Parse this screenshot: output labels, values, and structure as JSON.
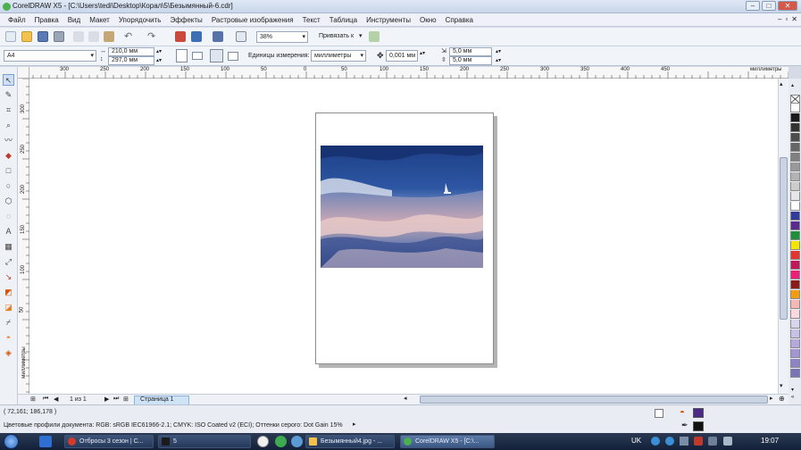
{
  "window": {
    "title": "CorelDRAW X5 - [C:\\Users\\tedi\\Desktop\\Корал\\5\\Безымянный-6.cdr]"
  },
  "menu": [
    "Файл",
    "Правка",
    "Вид",
    "Макет",
    "Упорядочить",
    "Эффекты",
    "Растровые изображения",
    "Текст",
    "Таблица",
    "Инструменты",
    "Окно",
    "Справка"
  ],
  "toolbar": {
    "zoom": "38%",
    "snap_label": "Привязать к"
  },
  "property_bar": {
    "paper_size": "A4",
    "width": "210,0 мм",
    "height": "297,0 мм",
    "units_label": "Единицы измерения:",
    "units": "миллиметры",
    "nudge": "0,001 мм",
    "dup_x": "5,0 мм",
    "dup_y": "5,0 мм"
  },
  "rulers": {
    "h_ticks": [
      "300",
      "250",
      "200",
      "150",
      "100",
      "50",
      "0",
      "50",
      "100",
      "150",
      "200",
      "250",
      "300",
      "350",
      "400",
      "450"
    ],
    "h_unit": "миллиметры",
    "v_ticks": [
      "300",
      "250",
      "200",
      "150",
      "100",
      "50"
    ],
    "v_unit": "миллиметры"
  },
  "page_nav": {
    "counter": "1 из 1",
    "tab": "Страница 1"
  },
  "status": {
    "coords": "( 72,161; 186,178 )",
    "profiles": "Цветовые профили документа: RGB: sRGB IEC61966-2.1; CMYK: ISO Coated v2 (ECI); Оттенки серого: Dot Gain 15%",
    "fill_color": "#4b2a8a",
    "outline_color": "#111111"
  },
  "palette": [
    "#ffffff",
    "#1a1a1a",
    "#333333",
    "#4d4d4d",
    "#666666",
    "#808080",
    "#999999",
    "#b3b3b3",
    "#cccccc",
    "#e6e6e6",
    "#ffffff",
    "#2f3c9c",
    "#5b2c8f",
    "#1f8f3a",
    "#f2e600",
    "#e3342f",
    "#c2185b",
    "#ee1d78",
    "#8b1a1a",
    "#f39c12",
    "#f5b7b1",
    "#f8d9e0",
    "#d9d4ee",
    "#c9c0e6",
    "#b6a8dc",
    "#a394d2",
    "#8f82c6",
    "#7b73b8"
  ],
  "taskbar": {
    "items": [
      "Отбросы 3 сезон | С...",
      "5",
      "Безымянный4.jpg - ...",
      "CorelDRAW X5 - [C:\\..."
    ],
    "lang": "UK",
    "clock": "19:07"
  }
}
